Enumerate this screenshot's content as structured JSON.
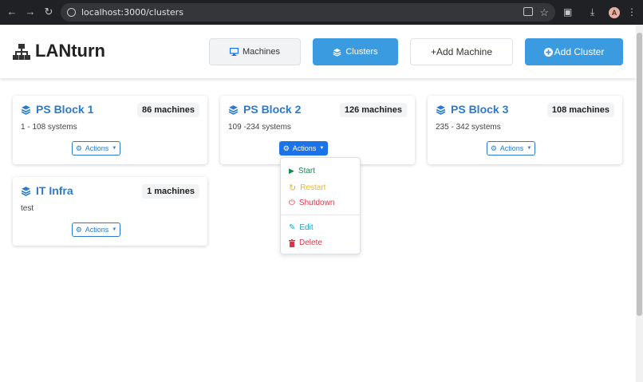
{
  "browser": {
    "url": "localhost:3000/clusters",
    "avatar_letter": "A"
  },
  "header": {
    "brand": "LANturn",
    "nav": {
      "machines_label": "Machines",
      "clusters_label": "Clusters",
      "add_machine_label": "+Add Machine",
      "add_cluster_label": "Add Cluster"
    }
  },
  "clusters": [
    {
      "name": "PS Block 1",
      "machines": "86 machines",
      "range": "1 - 108 systems"
    },
    {
      "name": "PS Block 2",
      "machines": "126 machines",
      "range": "109 -234 systems"
    },
    {
      "name": "PS Block 3",
      "machines": "108 machines",
      "range": "235 - 342 systems"
    },
    {
      "name": "IT Infra",
      "machines": "1 machines",
      "range": "test"
    }
  ],
  "actions_label": "Actions",
  "dropdown": {
    "items": [
      "Start",
      "Restart",
      "Shutdown",
      "Edit",
      "Delete"
    ]
  },
  "colors": {
    "primary": "#3b9be0",
    "link": "#2a7bcb",
    "start": "#198754",
    "restart": "#f0b429",
    "shutdown": "#dc3545",
    "edit": "#17a2b8",
    "delete": "#dc3545"
  }
}
